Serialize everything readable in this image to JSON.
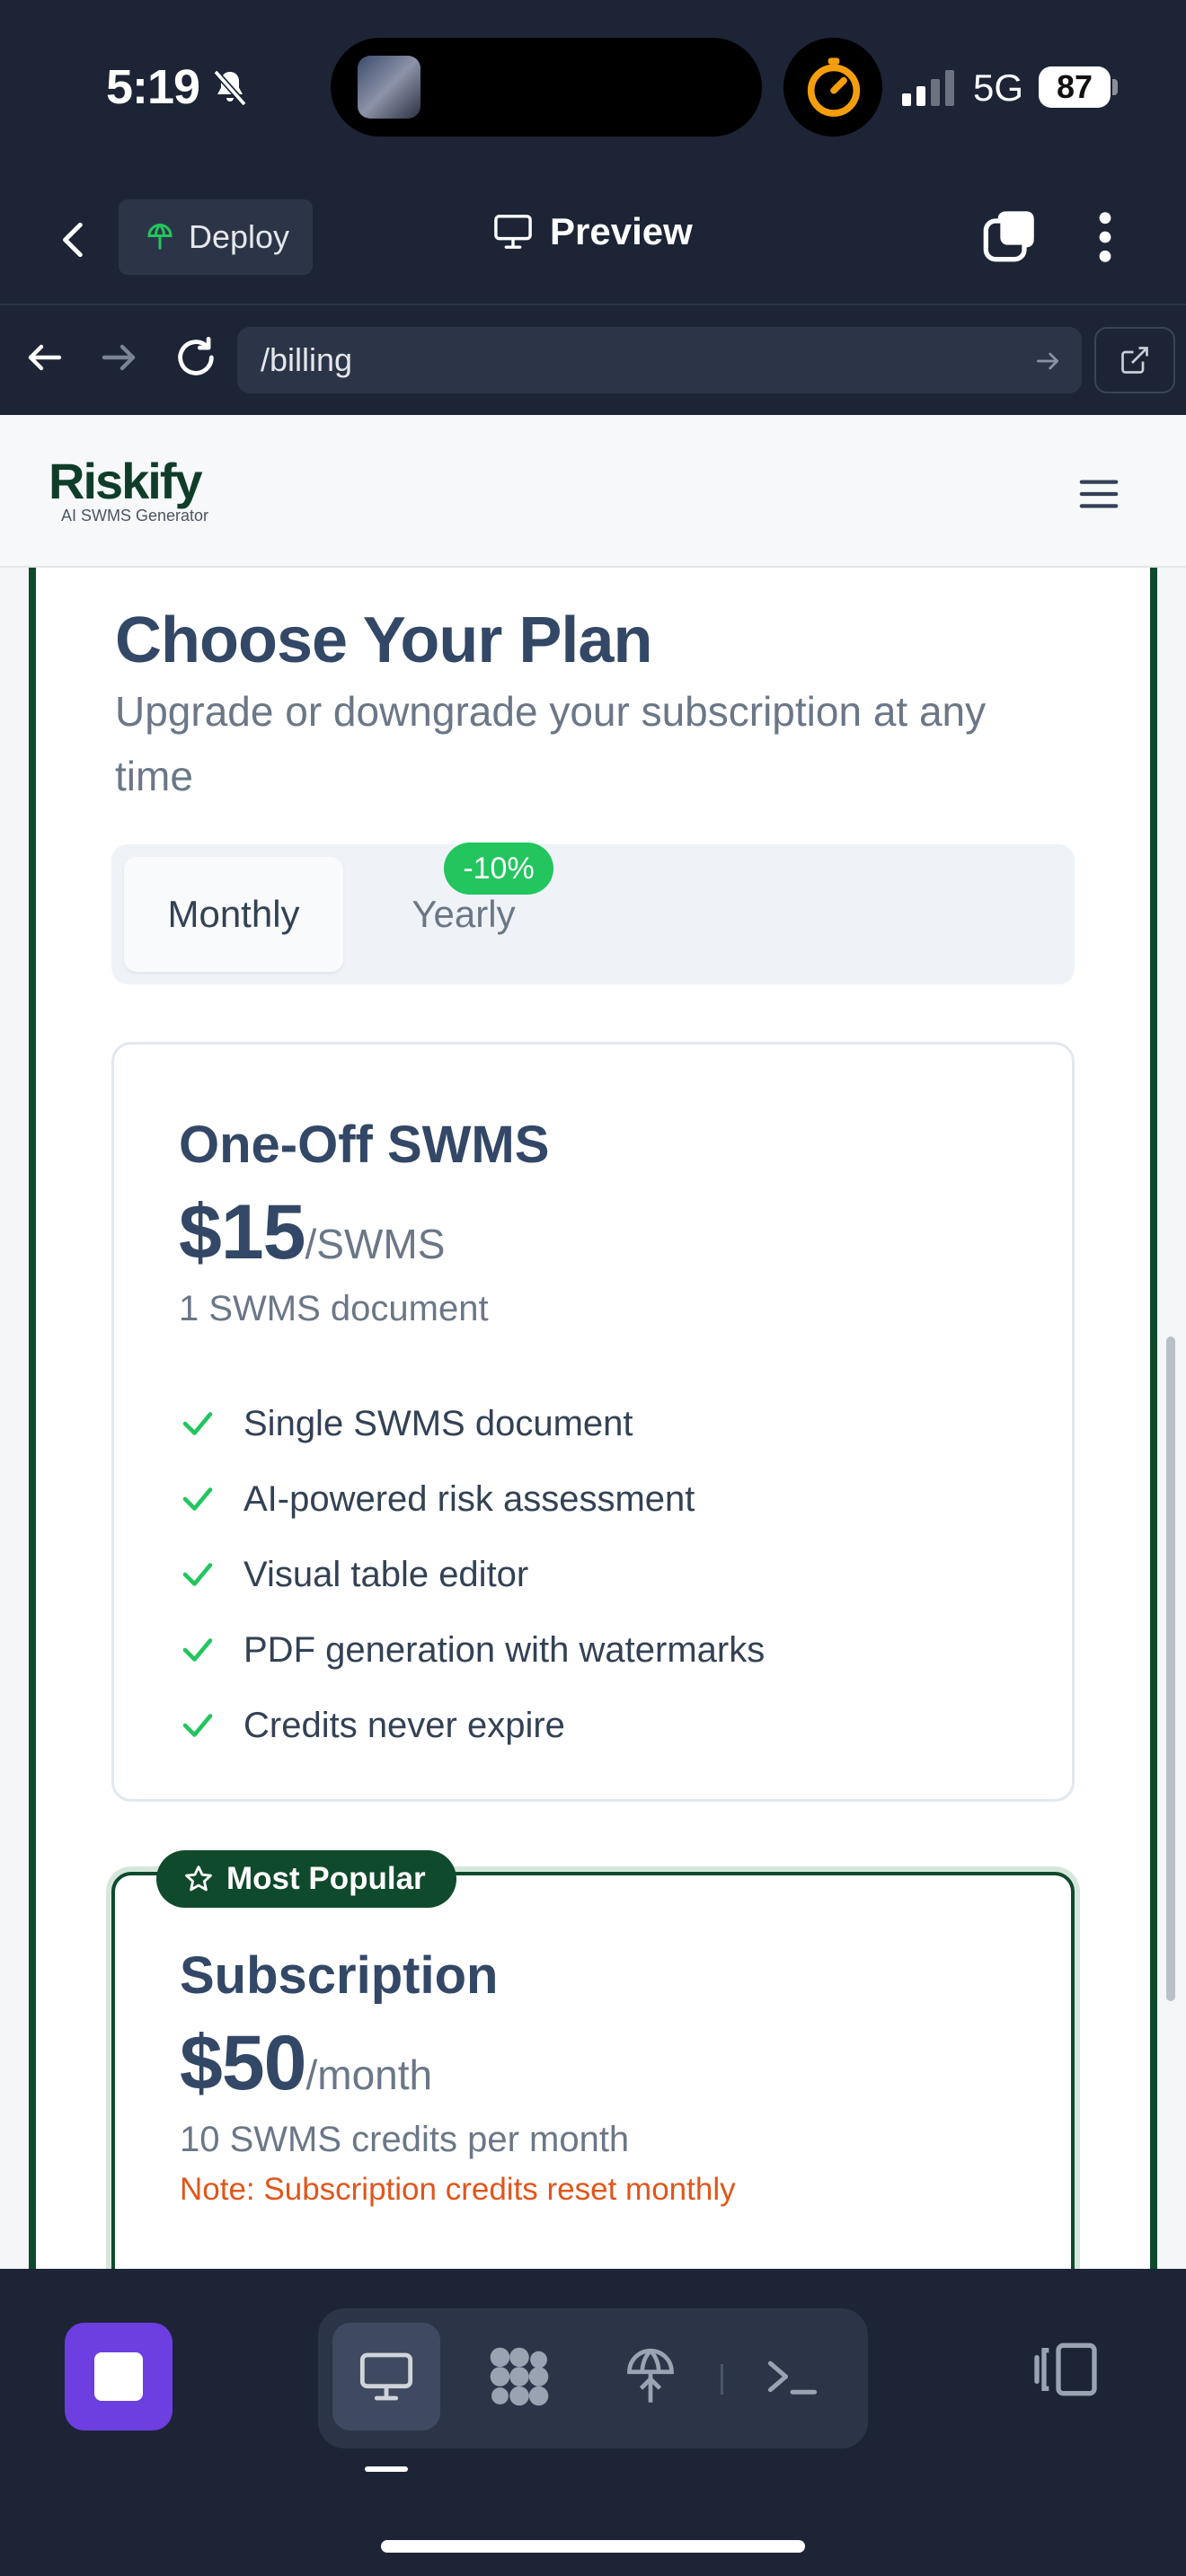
{
  "status_bar": {
    "time": "5:19",
    "network": "5G",
    "battery": "87"
  },
  "toolbar": {
    "deploy_label": "Deploy",
    "preview_label": "Preview"
  },
  "browser": {
    "url": "/billing"
  },
  "site": {
    "logo": "Riskify",
    "logo_tagline": "AI SWMS Generator"
  },
  "page": {
    "title": "Choose Your Plan",
    "subtitle": "Upgrade or downgrade your subscription at any time"
  },
  "billing_toggle": {
    "monthly_label": "Monthly",
    "yearly_label": "Yearly",
    "yearly_discount": "-10%",
    "selected": "Monthly"
  },
  "plans": [
    {
      "name": "One-Off SWMS",
      "price": "$15",
      "unit": "/SWMS",
      "description": "1 SWMS document",
      "features": [
        "Single SWMS document",
        "AI-powered risk assessment",
        "Visual table editor",
        "PDF generation with watermarks",
        "Credits never expire"
      ]
    },
    {
      "name": "Subscription",
      "badge": "Most Popular",
      "price": "$50",
      "unit": "/month",
      "description": "10 SWMS credits per month",
      "note": "Note: Subscription credits reset monthly"
    }
  ],
  "colors": {
    "brand_green": "#0f4a2c",
    "accent_green": "#22c55e",
    "note_orange": "#e0561b",
    "stop_purple": "#6d3ee0"
  }
}
